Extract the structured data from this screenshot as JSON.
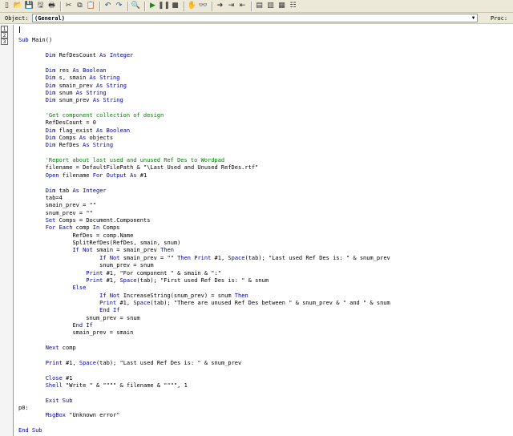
{
  "toolbar": {
    "buttons": [
      {
        "name": "new-icon",
        "glyph": "▯"
      },
      {
        "name": "open-icon",
        "glyph": "📂"
      },
      {
        "name": "save-icon",
        "glyph": "💾"
      },
      {
        "name": "save-all-icon",
        "glyph": "🖫"
      },
      {
        "name": "print-icon",
        "glyph": "🖶"
      },
      {
        "name": "cut-icon",
        "glyph": "✂"
      },
      {
        "name": "copy-icon",
        "glyph": "⧉"
      },
      {
        "name": "paste-icon",
        "glyph": "📋"
      },
      {
        "name": "undo-icon",
        "glyph": "↶"
      },
      {
        "name": "redo-icon",
        "glyph": "↷"
      },
      {
        "name": "find-icon",
        "glyph": "🔍"
      },
      {
        "name": "run-icon",
        "glyph": "▶"
      },
      {
        "name": "pause-icon",
        "glyph": "❚❚"
      },
      {
        "name": "stop-icon",
        "glyph": "■"
      },
      {
        "name": "breakpoint-hand-icon",
        "glyph": "✋"
      },
      {
        "name": "watch-icon",
        "glyph": "👓"
      },
      {
        "name": "step-into-icon",
        "glyph": "➔"
      },
      {
        "name": "step-over-icon",
        "glyph": "⇥"
      },
      {
        "name": "step-out-icon",
        "glyph": "⇤"
      },
      {
        "name": "locals-icon",
        "glyph": "▤"
      },
      {
        "name": "immediate-icon",
        "glyph": "▥"
      },
      {
        "name": "object-browser-icon",
        "glyph": "▦"
      },
      {
        "name": "properties-icon",
        "glyph": "☷"
      }
    ]
  },
  "object_bar": {
    "object_label": "Object:",
    "object_value": "(General)",
    "proc_label": "Proc:"
  },
  "gutter": {
    "line_numbers": [
      "1",
      "2",
      "3"
    ]
  },
  "colors": {
    "keyword": "#0000a0",
    "comment": "#008000",
    "text": "#000000"
  },
  "code_lines": [
    "",
    "Sub Main()",
    "",
    "        Dim RefDesCount As Integer",
    "",
    "        Dim res As Boolean",
    "        Dim s, smain As String",
    "        Dim smain_prev As String",
    "        Dim snum As String",
    "        Dim snum_prev As String",
    "",
    "        'Get component collection of design",
    "        RefDesCount = 0",
    "        Dim flag_exist As Boolean",
    "        Dim Comps As objects",
    "        Dim RefDes As String",
    "",
    "        'Report about last used and unused Ref Des to Wordpad",
    "        filename = DefaultFilePath & \"\\Last Used and Unused RefDes.rtf\"",
    "        Open filename For Output As #1",
    "",
    "        Dim tab As Integer",
    "        tab=4",
    "        smain_prev = \"\"",
    "        snum_prev = \"\"",
    "        Set Comps = Document.Components",
    "        For Each comp In Comps",
    "                RefDes = comp.Name",
    "                SplitRefDes(RefDes, smain, snum)",
    "                If Not smain = smain_prev Then",
    "                        If Not smain_prev = \"\" Then Print #1, Space(tab); \"Last used Ref Des is: \" & snum_prev",
    "                        snum_prev = snum",
    "                    Print #1, \"For component \" & smain & \":\"",
    "                    Print #1, Space(tab); \"First used Ref Des is: \" & snum",
    "                Else",
    "                        If Not IncreaseString(snum_prev) = snum Then",
    "                        Print #1, Space(tab); \"There are unused Ref Des between \" & snum_prev & \" and \" & snum",
    "                        End If",
    "                    snum_prev = snum",
    "                End If",
    "                smain_prev = smain",
    "",
    "        Next comp",
    "",
    "        Print #1, Space(tab); \"Last used Ref Des is: \" & snum_prev",
    "",
    "        Close #1",
    "        Shell \"Write \" & \"\"\"\" & filename & \"\"\"\", 1",
    "",
    "        Exit Sub",
    "p0:",
    "        MsgBox \"Unknown error\"",
    "",
    "End Sub"
  ]
}
